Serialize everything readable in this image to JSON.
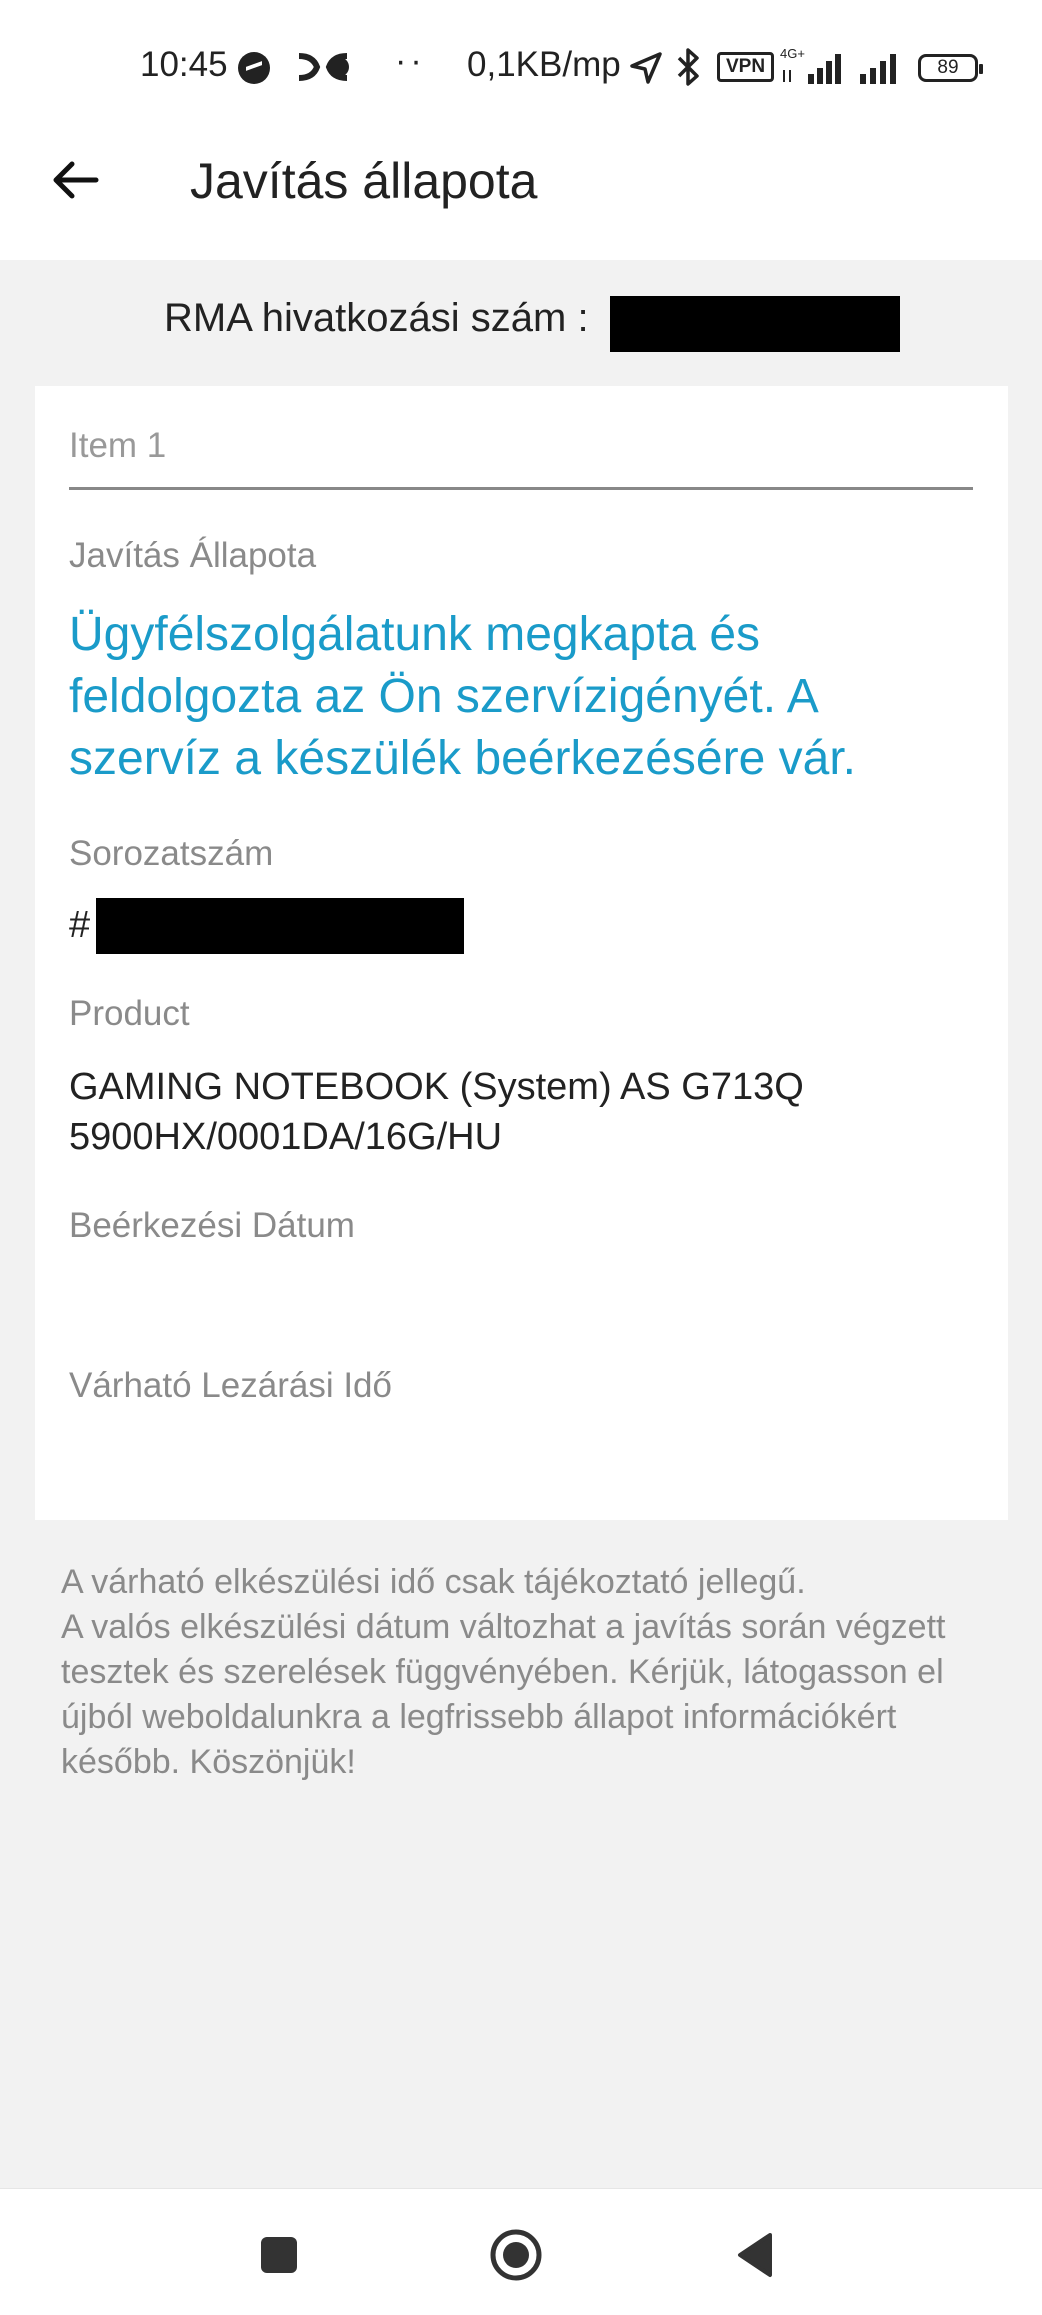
{
  "status_bar": {
    "time": "10:45",
    "dots": "··",
    "speed": "0,1KB/mp",
    "vpn": "VPN",
    "battery": "89"
  },
  "app_bar": {
    "title": "Javítás állapota"
  },
  "rma": {
    "label": "RMA hivatkozási szám :"
  },
  "card": {
    "item_title": "Item 1",
    "repair_status_label": "Javítás Állapota",
    "repair_status_value": "Ügyfélszolgálatunk megkapta és feldolgozta az Ön szervízigényét. A szervíz a készülék beérkezésére vár.",
    "serial_label": "Sorozatszám",
    "serial_prefix": "#",
    "product_label": "Product",
    "product_value_line1": "GAMING NOTEBOOK (System) AS G713Q",
    "product_value_line2": "5900HX/0001DA/16G/HU",
    "arrival_date_label": "Beérkezési Dátum",
    "expected_close_label": "Várható Lezárási Idő"
  },
  "footnote": {
    "line1": "A várható elkészülési idő csak tájékoztató jellegű.",
    "line2": "A valós elkészülési dátum változhat a javítás során végzett tesztek és szerelések függvényében. Kérjük, látogasson el újból weboldalunkra a legfrissebb állapot információkért később. Köszönjük!"
  },
  "colors": {
    "accent": "#1a9bc9",
    "background": "#f2f2f2",
    "card": "#ffffff",
    "muted_text": "#8a8a8a"
  }
}
